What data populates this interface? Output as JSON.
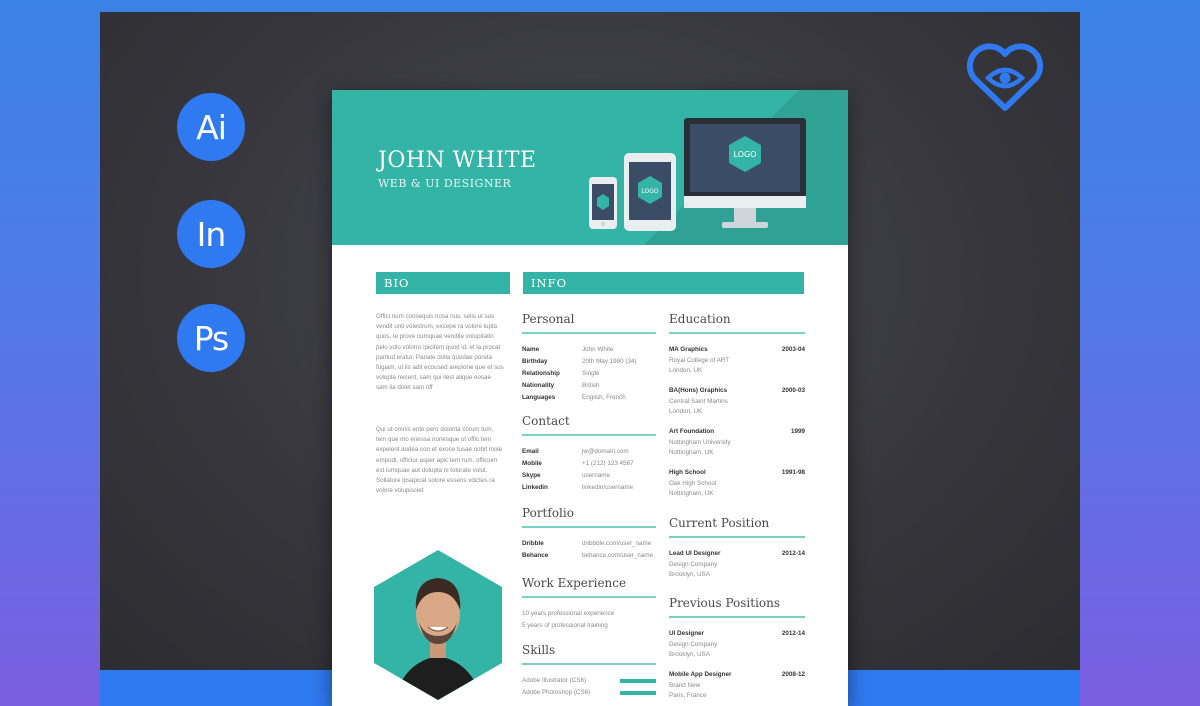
{
  "tools": [
    {
      "label": "Ai",
      "icon": "illustrator-icon"
    },
    {
      "label": "In",
      "icon": "indesign-icon"
    },
    {
      "label": "Ps",
      "icon": "photoshop-icon"
    }
  ],
  "colors": {
    "accent": "#34b4a6",
    "brand_blue": "#2f7af0",
    "backdrop": "#37373d"
  },
  "resume": {
    "name": "JOHN WHITE",
    "role": "WEB & UI DESIGNER",
    "device_logo": "LOGO",
    "bio_header": "BIO",
    "info_header": "INFO",
    "bio_p1": "Offici num consequis nosa nus, selis ut sus vendit unti volestrum, excepe ra volore lupta quos, te prove cumquae vendite volupitatin pelo volo volorro ipicitem quod id, et la procat paritud eratur. Pariate dolla quodae poreta fugiam, ut lis adit ecoused arepione que et sus volupta reicent, sam qui ilest alique eosae sam lia dolet sam off",
    "bio_p2": "Qui ut omnis ente pero dolorita corum tum, tem que mo enessa nonesque ut offic tem expelent audea con et exoce tusae nobit mole empodi, officiur asper apic tem rum, officium est iumquae aut dolupta ni tolorate volut. Sollatore ipsapicat solore essens vdictes ra volore volupisciet",
    "personal": {
      "title": "Personal",
      "rows": [
        {
          "key": "Name",
          "value": "John White"
        },
        {
          "key": "Birthday",
          "value": "20th May 1980 (34)"
        },
        {
          "key": "Relationship",
          "value": "Single"
        },
        {
          "key": "Nationality",
          "value": "British"
        },
        {
          "key": "Languages",
          "value": "English, French"
        }
      ]
    },
    "contact": {
      "title": "Contact",
      "rows": [
        {
          "key": "Email",
          "value": "jw@domain.com"
        },
        {
          "key": "Mobile",
          "value": "+1 (212) 123 4567"
        },
        {
          "key": "Skype",
          "value": "username"
        },
        {
          "key": "Linkedin",
          "value": "linkedin/username"
        }
      ]
    },
    "portfolio": {
      "title": "Portfolio",
      "rows": [
        {
          "key": "Dribble",
          "value": "dribbble.com/user_name"
        },
        {
          "key": "Behance",
          "value": "behance.com/user_name"
        }
      ]
    },
    "work": {
      "title": "Work Experience",
      "lines": [
        "10 years professional experience",
        "5 years of professional training"
      ]
    },
    "skills": {
      "title": "Skills",
      "items": [
        {
          "label": "Adobe Illustrator (CS6)",
          "level": 0.9
        },
        {
          "label": "Adobe Photoshop (CS6)",
          "level": 0.9
        }
      ]
    },
    "education": {
      "title": "Education",
      "items": [
        {
          "title": "MA Graphics",
          "date": "2003-04",
          "line1": "Royal College of ART",
          "line2": "London, UK"
        },
        {
          "title": "BA(Hons) Graphics",
          "date": "2000-03",
          "line1": "Central Saint Martins",
          "line2": "London, UK"
        },
        {
          "title": "Art Foundation",
          "date": "1999",
          "line1": "Nottingham University",
          "line2": "Nottingham, UK"
        },
        {
          "title": "High School",
          "date": "1991-98",
          "line1": "Oak High School",
          "line2": "Nottingham, UK"
        }
      ]
    },
    "current": {
      "title": "Current Position",
      "items": [
        {
          "title": "Lead UI Designer",
          "date": "2012-14",
          "line1": "Design Company",
          "line2": "Brooklyn, USA"
        }
      ]
    },
    "previous": {
      "title": "Previous Positions",
      "items": [
        {
          "title": "UI Designer",
          "date": "2012-14",
          "line1": "Design Company",
          "line2": "Brooklyn, USA"
        },
        {
          "title": "Mobile App Designer",
          "date": "2008-12",
          "line1": "Brand New",
          "line2": "Paris, France"
        }
      ]
    }
  }
}
